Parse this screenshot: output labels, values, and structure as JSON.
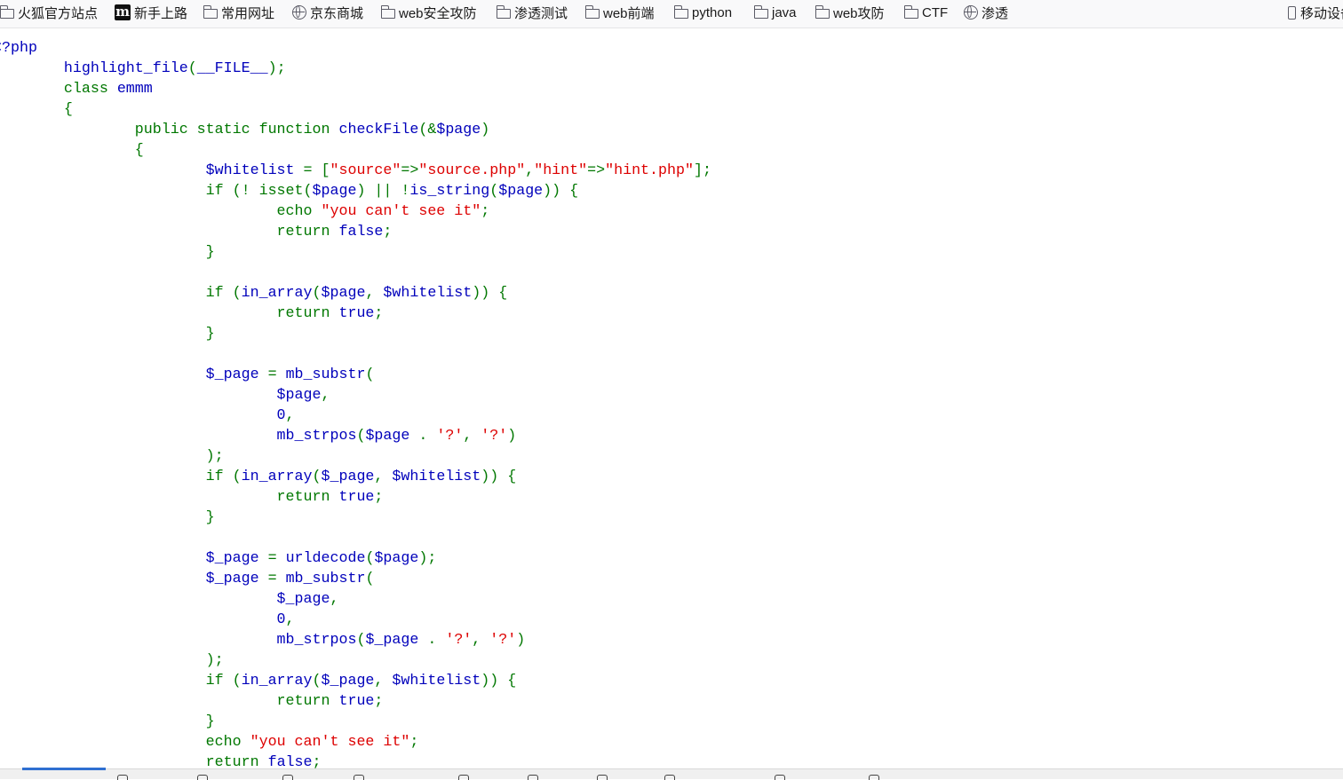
{
  "bookmarks": {
    "items": [
      {
        "label": "火狐官方站点",
        "icon": "folder-icon"
      },
      {
        "label": "新手上路",
        "icon": "m-logo-icon"
      },
      {
        "label": "常用网址",
        "icon": "folder-icon"
      },
      {
        "label": "京东商城",
        "icon": "globe-icon"
      },
      {
        "label": "web安全攻防",
        "icon": "folder-icon"
      },
      {
        "label": "渗透测试",
        "icon": "folder-icon"
      },
      {
        "label": "web前端",
        "icon": "folder-icon"
      },
      {
        "label": "python",
        "icon": "folder-icon"
      },
      {
        "label": "java",
        "icon": "folder-icon"
      },
      {
        "label": "web攻防",
        "icon": "folder-icon"
      },
      {
        "label": "CTF",
        "icon": "folder-icon"
      },
      {
        "label": "渗透",
        "icon": "globe-icon"
      }
    ],
    "mobile": {
      "label": "移动设备",
      "icon": "mobile-icon"
    },
    "m_logo_glyph": "m"
  },
  "colors": {
    "default": "#0000bb",
    "keyword": "#007700",
    "string": "#dd0000"
  },
  "code": {
    "lines": [
      [
        {
          "t": "<?php",
          "c": "default"
        }
      ],
      [
        {
          "t": "        highlight_file",
          "c": "default"
        },
        {
          "t": "(",
          "c": "keyword"
        },
        {
          "t": "__FILE__",
          "c": "default"
        },
        {
          "t": ");",
          "c": "keyword"
        }
      ],
      [
        {
          "t": "        class ",
          "c": "keyword"
        },
        {
          "t": "emmm",
          "c": "default"
        }
      ],
      [
        {
          "t": "        {",
          "c": "keyword"
        }
      ],
      [
        {
          "t": "                public static function ",
          "c": "keyword"
        },
        {
          "t": "checkFile",
          "c": "default"
        },
        {
          "t": "(&",
          "c": "keyword"
        },
        {
          "t": "$page",
          "c": "default"
        },
        {
          "t": ")",
          "c": "keyword"
        }
      ],
      [
        {
          "t": "                {",
          "c": "keyword"
        }
      ],
      [
        {
          "t": "                        $whitelist ",
          "c": "default"
        },
        {
          "t": "= [",
          "c": "keyword"
        },
        {
          "t": "\"source\"",
          "c": "string"
        },
        {
          "t": "=>",
          "c": "keyword"
        },
        {
          "t": "\"source.php\"",
          "c": "string"
        },
        {
          "t": ",",
          "c": "keyword"
        },
        {
          "t": "\"hint\"",
          "c": "string"
        },
        {
          "t": "=>",
          "c": "keyword"
        },
        {
          "t": "\"hint.php\"",
          "c": "string"
        },
        {
          "t": "];",
          "c": "keyword"
        }
      ],
      [
        {
          "t": "                        if (! isset(",
          "c": "keyword"
        },
        {
          "t": "$page",
          "c": "default"
        },
        {
          "t": ") || !",
          "c": "keyword"
        },
        {
          "t": "is_string",
          "c": "default"
        },
        {
          "t": "(",
          "c": "keyword"
        },
        {
          "t": "$page",
          "c": "default"
        },
        {
          "t": ")) {",
          "c": "keyword"
        }
      ],
      [
        {
          "t": "                                echo ",
          "c": "keyword"
        },
        {
          "t": "\"you can't see it\"",
          "c": "string"
        },
        {
          "t": ";",
          "c": "keyword"
        }
      ],
      [
        {
          "t": "                                return ",
          "c": "keyword"
        },
        {
          "t": "false",
          "c": "default"
        },
        {
          "t": ";",
          "c": "keyword"
        }
      ],
      [
        {
          "t": "                        }",
          "c": "keyword"
        }
      ],
      [
        {
          "t": "",
          "c": "keyword"
        }
      ],
      [
        {
          "t": "                        if (",
          "c": "keyword"
        },
        {
          "t": "in_array",
          "c": "default"
        },
        {
          "t": "(",
          "c": "keyword"
        },
        {
          "t": "$page",
          "c": "default"
        },
        {
          "t": ", ",
          "c": "keyword"
        },
        {
          "t": "$whitelist",
          "c": "default"
        },
        {
          "t": ")) {",
          "c": "keyword"
        }
      ],
      [
        {
          "t": "                                return ",
          "c": "keyword"
        },
        {
          "t": "true",
          "c": "default"
        },
        {
          "t": ";",
          "c": "keyword"
        }
      ],
      [
        {
          "t": "                        }",
          "c": "keyword"
        }
      ],
      [
        {
          "t": "",
          "c": "keyword"
        }
      ],
      [
        {
          "t": "                        $_page ",
          "c": "default"
        },
        {
          "t": "= ",
          "c": "keyword"
        },
        {
          "t": "mb_substr",
          "c": "default"
        },
        {
          "t": "(",
          "c": "keyword"
        }
      ],
      [
        {
          "t": "                                $page",
          "c": "default"
        },
        {
          "t": ",",
          "c": "keyword"
        }
      ],
      [
        {
          "t": "                                0",
          "c": "default"
        },
        {
          "t": ",",
          "c": "keyword"
        }
      ],
      [
        {
          "t": "                                mb_strpos",
          "c": "default"
        },
        {
          "t": "(",
          "c": "keyword"
        },
        {
          "t": "$page ",
          "c": "default"
        },
        {
          "t": ". ",
          "c": "keyword"
        },
        {
          "t": "'?'",
          "c": "string"
        },
        {
          "t": ", ",
          "c": "keyword"
        },
        {
          "t": "'?'",
          "c": "string"
        },
        {
          "t": ")",
          "c": "keyword"
        }
      ],
      [
        {
          "t": "                        );",
          "c": "keyword"
        }
      ],
      [
        {
          "t": "                        if (",
          "c": "keyword"
        },
        {
          "t": "in_array",
          "c": "default"
        },
        {
          "t": "(",
          "c": "keyword"
        },
        {
          "t": "$_page",
          "c": "default"
        },
        {
          "t": ", ",
          "c": "keyword"
        },
        {
          "t": "$whitelist",
          "c": "default"
        },
        {
          "t": ")) {",
          "c": "keyword"
        }
      ],
      [
        {
          "t": "                                return ",
          "c": "keyword"
        },
        {
          "t": "true",
          "c": "default"
        },
        {
          "t": ";",
          "c": "keyword"
        }
      ],
      [
        {
          "t": "                        }",
          "c": "keyword"
        }
      ],
      [
        {
          "t": "",
          "c": "keyword"
        }
      ],
      [
        {
          "t": "                        $_page ",
          "c": "default"
        },
        {
          "t": "= ",
          "c": "keyword"
        },
        {
          "t": "urldecode",
          "c": "default"
        },
        {
          "t": "(",
          "c": "keyword"
        },
        {
          "t": "$page",
          "c": "default"
        },
        {
          "t": ");",
          "c": "keyword"
        }
      ],
      [
        {
          "t": "                        $_page ",
          "c": "default"
        },
        {
          "t": "= ",
          "c": "keyword"
        },
        {
          "t": "mb_substr",
          "c": "default"
        },
        {
          "t": "(",
          "c": "keyword"
        }
      ],
      [
        {
          "t": "                                $_page",
          "c": "default"
        },
        {
          "t": ",",
          "c": "keyword"
        }
      ],
      [
        {
          "t": "                                0",
          "c": "default"
        },
        {
          "t": ",",
          "c": "keyword"
        }
      ],
      [
        {
          "t": "                                mb_strpos",
          "c": "default"
        },
        {
          "t": "(",
          "c": "keyword"
        },
        {
          "t": "$_page ",
          "c": "default"
        },
        {
          "t": ". ",
          "c": "keyword"
        },
        {
          "t": "'?'",
          "c": "string"
        },
        {
          "t": ", ",
          "c": "keyword"
        },
        {
          "t": "'?'",
          "c": "string"
        },
        {
          "t": ")",
          "c": "keyword"
        }
      ],
      [
        {
          "t": "                        );",
          "c": "keyword"
        }
      ],
      [
        {
          "t": "                        if (",
          "c": "keyword"
        },
        {
          "t": "in_array",
          "c": "default"
        },
        {
          "t": "(",
          "c": "keyword"
        },
        {
          "t": "$_page",
          "c": "default"
        },
        {
          "t": ", ",
          "c": "keyword"
        },
        {
          "t": "$whitelist",
          "c": "default"
        },
        {
          "t": ")) {",
          "c": "keyword"
        }
      ],
      [
        {
          "t": "                                return ",
          "c": "keyword"
        },
        {
          "t": "true",
          "c": "default"
        },
        {
          "t": ";",
          "c": "keyword"
        }
      ],
      [
        {
          "t": "                        }",
          "c": "keyword"
        }
      ],
      [
        {
          "t": "                        echo ",
          "c": "keyword"
        },
        {
          "t": "\"you can't see it\"",
          "c": "string"
        },
        {
          "t": ";",
          "c": "keyword"
        }
      ],
      [
        {
          "t": "                        return ",
          "c": "keyword"
        },
        {
          "t": "false",
          "c": "default"
        },
        {
          "t": ";",
          "c": "keyword"
        }
      ]
    ]
  }
}
